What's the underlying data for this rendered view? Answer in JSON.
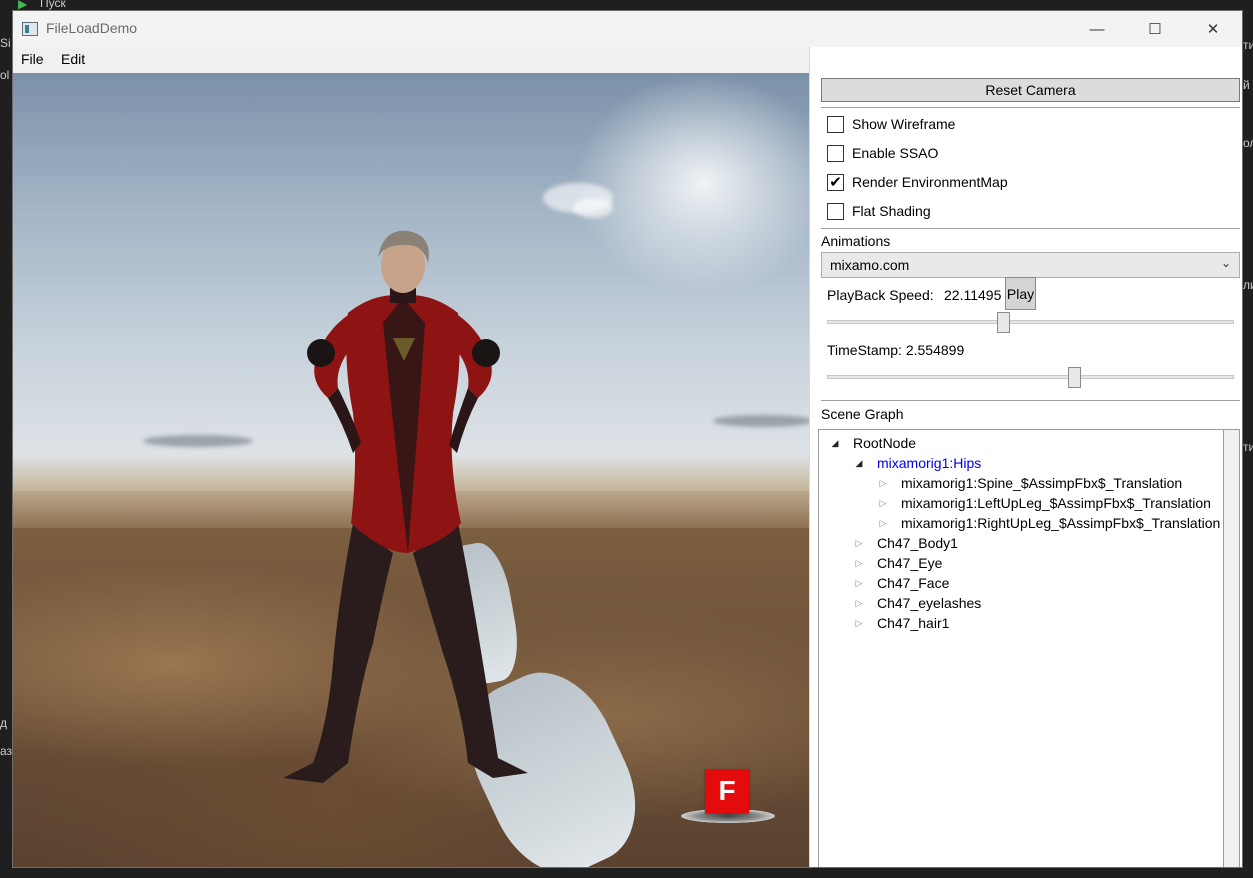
{
  "ide": {
    "run_label": "Пуск",
    "fragments": [
      "Si",
      "ol",
      "ти",
      "й",
      "ол",
      "ли",
      "ти",
      "д",
      "аз"
    ]
  },
  "window": {
    "title": "FileLoadDemo",
    "minimize_glyph": "—",
    "maximize_glyph": "☐",
    "close_glyph": "✕"
  },
  "menu": {
    "file_label": "File",
    "edit_label": "Edit"
  },
  "viewport": {
    "marker_label": "F"
  },
  "panel": {
    "reset_camera_label": "Reset Camera",
    "checkboxes": [
      {
        "label": "Show Wireframe",
        "checked": false
      },
      {
        "label": "Enable SSAO",
        "checked": false
      },
      {
        "label": "Render EnvironmentMap",
        "checked": true
      },
      {
        "label": "Flat Shading",
        "checked": false
      }
    ],
    "animations_label": "Animations",
    "animation_selected": "mixamo.com",
    "playback_speed_label": "PlayBack Speed:",
    "playback_speed_value": "22.11495",
    "play_label": "Play",
    "playback_slider_fraction": 0.43,
    "timestamp_label": "TimeStamp: 2.554899",
    "timestamp_slider_fraction": 0.61,
    "scene_graph_label": "Scene Graph"
  },
  "scene_graph": {
    "items": [
      {
        "label": "RootNode",
        "depth": 0,
        "expanded": true,
        "selected": false
      },
      {
        "label": "mixamorig1:Hips",
        "depth": 1,
        "expanded": true,
        "selected": true
      },
      {
        "label": "mixamorig1:Spine_$AssimpFbx$_Translation",
        "depth": 2,
        "expanded": false,
        "selected": false
      },
      {
        "label": "mixamorig1:LeftUpLeg_$AssimpFbx$_Translation",
        "depth": 2,
        "expanded": false,
        "selected": false
      },
      {
        "label": "mixamorig1:RightUpLeg_$AssimpFbx$_Translation",
        "depth": 2,
        "expanded": false,
        "selected": false
      },
      {
        "label": "Ch47_Body1",
        "depth": 1,
        "expanded": false,
        "selected": false
      },
      {
        "label": "Ch47_Eye",
        "depth": 1,
        "expanded": false,
        "selected": false
      },
      {
        "label": "Ch47_Face",
        "depth": 1,
        "expanded": false,
        "selected": false
      },
      {
        "label": "Ch47_eyelashes",
        "depth": 1,
        "expanded": false,
        "selected": false
      },
      {
        "label": "Ch47_hair1",
        "depth": 1,
        "expanded": false,
        "selected": false
      }
    ]
  },
  "colors": {
    "selected_node": "#0000e6",
    "marker_red": "#e30b0b",
    "suit_red": "#8e1414"
  }
}
